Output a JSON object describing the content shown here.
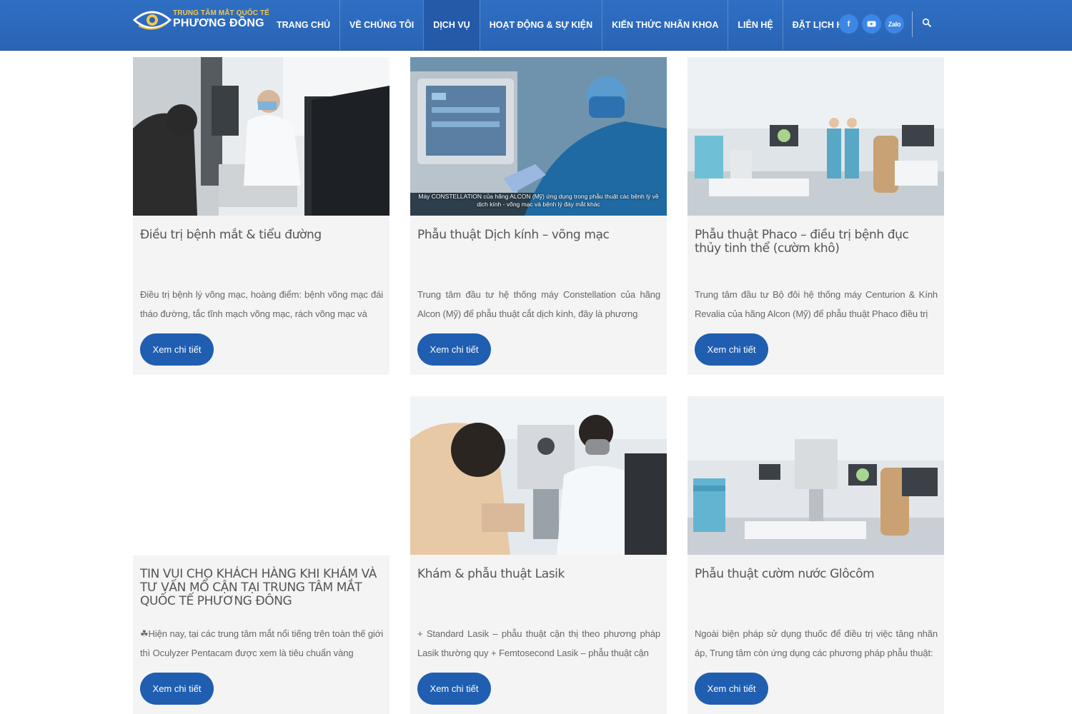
{
  "header": {
    "logo_line1": "TRUNG TÂM MẮT QUỐC TẾ",
    "logo_line2": "PHƯƠNG ĐÔNG",
    "nav": [
      {
        "label": "TRANG CHỦ"
      },
      {
        "label": "VỀ CHÚNG TÔI"
      },
      {
        "label": "DỊCH VỤ"
      },
      {
        "label": "HOẠT ĐỘNG & SỰ KIỆN"
      },
      {
        "label": "KIẾN THỨC NHÃN KHOA"
      },
      {
        "label": "LIÊN HỆ"
      },
      {
        "label": "ĐẶT LỊCH HẸN"
      }
    ],
    "active_nav": "DỊCH VỤ",
    "socials": {
      "facebook": "f",
      "zalo": "Zalo"
    },
    "colors": {
      "bar": "#2a64b5",
      "social": "#3d86e6",
      "logo_accent": "#f3c64a"
    }
  },
  "cards": [
    {
      "title": "Điều trị bệnh mắt & tiểu đường",
      "excerpt": "Điều trị bệnh lý võng mạc, hoàng điểm: bệnh võng mạc đái tháo đường, tắc tĩnh mạch võng mạc, rách võng mạc và",
      "button": "Xem chi tiết",
      "image": "eye-exam-photo"
    },
    {
      "title": "Phẫu thuật Dịch kính – võng mạc",
      "excerpt": "Trung tâm đầu tư hệ thống máy Constellation của hãng Alcon (Mỹ) để phẫu thuật cắt dịch kính, đây là phương",
      "button": "Xem chi tiết",
      "image": "surgeon-machine-photo",
      "caption": "Máy CONSTELLATION của hãng ALCON (Mỹ) ứng dụng trong phẫu thuật các bệnh lý về dịch kính - võng mạc và bệnh lý đáy mắt khác"
    },
    {
      "title": "Phẫu thuật Phaco – điều trị bệnh đục thủy tinh thể (cườm khô)",
      "excerpt": "Trung tâm đầu tư Bộ đôi hệ thống máy Centurion & Kính Revalia của hãng Alcon (Mỹ) để phẫu thuật Phaco điều trị",
      "button": "Xem chi tiết",
      "image": "operating-room-photo"
    },
    {
      "title": "TIN VUI CHO KHÁCH HÀNG KHI KHÁM VÀ TƯ VẤN MỔ CẬN TẠI TRUNG TÂM MẮT QUỐC TẾ PHƯƠNG ĐÔNG",
      "excerpt": "☘Hiện nay, tại các trung tâm mắt nổi tiếng trên toàn thế giới thì Oculyzer Pentacam được xem là tiêu chuẩn vàng",
      "button": "Xem chi tiết",
      "image": "empty"
    },
    {
      "title": "Khám & phẫu thuật Lasik",
      "excerpt": "+ Standard Lasik – phẫu thuật cận thị theo phương pháp Lasik thường quy + Femtosecond Lasik – phẫu thuật cận",
      "button": "Xem chi tiết",
      "image": "slit-lamp-exam-photo"
    },
    {
      "title": "Phẫu thuật cườm nước Glôcôm",
      "excerpt": "Ngoài biện pháp sử dụng thuốc để điều trị việc tăng nhãn áp, Trung tâm còn ứng dụng các phương pháp phẫu thuật:",
      "button": "Xem chi tiết",
      "image": "operating-room-photo-2"
    }
  ]
}
